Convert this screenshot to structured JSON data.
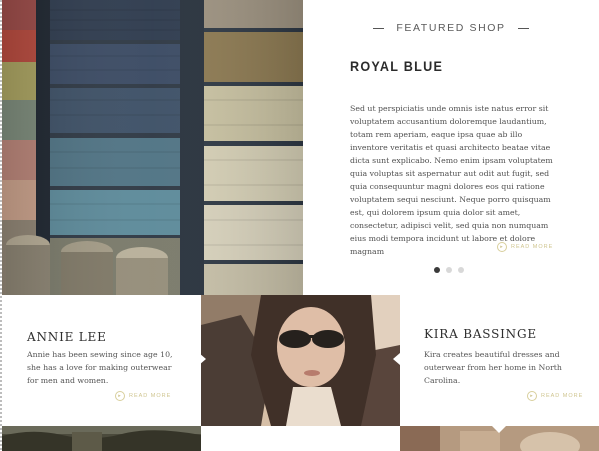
{
  "featured": {
    "eyebrow": "FEATURED SHOP",
    "title": "ROYAL BLUE",
    "body": "Sed ut perspiciatis unde omnis iste natus error sit voluptatem accusantium doloremque laudantium, totam rem aperiam, eaque ipsa quae ab illo inventore veritatis et quasi architecto beatae vitae dicta sunt explicabo. Nemo enim ipsam voluptatem quia voluptas sit aspernatur aut odit aut fugit, sed quia consequuntur magni dolores eos qui ratione voluptatem sequi nesciunt. Neque porro quisquam est, qui dolorem ipsum quia dolor sit amet, consectetur, adipisci velit, sed quia non numquam eius modi tempora incidunt ut labore et dolore magnam",
    "read_more": "READ MORE",
    "slides": 3,
    "active_slide": 1
  },
  "profiles": [
    {
      "name": "ANNIE LEE",
      "bio": "Annie has been sewing since age 10, she has a love for making outerwear for men and women.",
      "read_more": "READ MORE"
    },
    {
      "name": "KIRA BASSINGE",
      "bio": "Kira creates beautiful dresses and outerwear from her home in North Carolina.",
      "read_more": "READ MORE"
    }
  ],
  "images": {
    "thread_photo": "thread-spools-photo",
    "portrait_photo": "woman-sunglasses-portrait-photo"
  },
  "colors": {
    "accent": "#cfc58f",
    "text_dark": "#2b2b2b",
    "dot_active": "#3a3a3a",
    "dot_inactive": "#d8d8d8"
  }
}
